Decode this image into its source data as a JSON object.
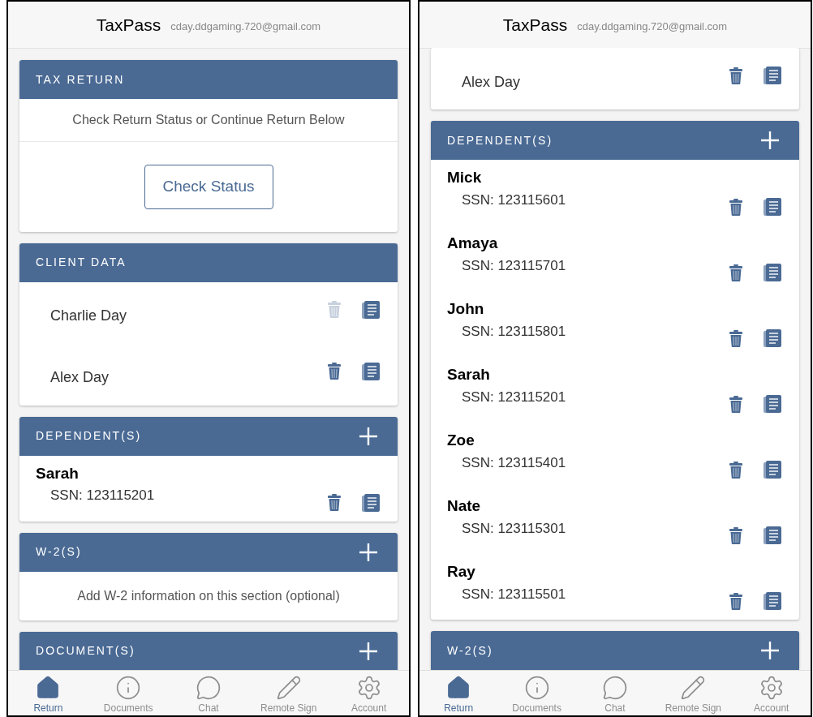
{
  "phones": [
    {
      "app_title": "TaxPass",
      "email": "cday.ddgaming.720@gmail.com",
      "sections": [
        {
          "kind": "status",
          "header": "TAX RETURN",
          "message": "Check Return Status or Continue Return Below",
          "button": "Check Status"
        },
        {
          "kind": "people",
          "header": "CLIENT DATA",
          "rows": [
            {
              "name": "Charlie Day",
              "delete_disabled": true
            },
            {
              "name": "Alex Day",
              "delete_disabled": false
            }
          ]
        },
        {
          "kind": "dependents",
          "header": "DEPENDENT(S)",
          "add": true,
          "rows": [
            {
              "name": "Sarah",
              "ssn": "SSN: 123115201",
              "delete_disabled": false
            }
          ]
        },
        {
          "kind": "note",
          "header": "W-2(S)",
          "add": true,
          "message": "Add W-2 information on this section (optional)"
        },
        {
          "kind": "header",
          "header": "DOCUMENT(S)",
          "add": true
        }
      ],
      "nav": [
        {
          "label": "Return",
          "selected": true
        },
        {
          "label": "Documents",
          "selected": false
        },
        {
          "label": "Chat",
          "selected": false
        },
        {
          "label": "Remote Sign",
          "selected": false
        },
        {
          "label": "Account",
          "selected": false
        }
      ]
    },
    {
      "app_title": "TaxPass",
      "email": "cday.ddgaming.720@gmail.com",
      "sections": [
        {
          "kind": "people",
          "rows": [
            {
              "name": "Alex Day",
              "delete_disabled": false
            }
          ]
        },
        {
          "kind": "dependents",
          "header": "DEPENDENT(S)",
          "add": true,
          "rows": [
            {
              "name": "Mick",
              "ssn": "SSN: 123115601",
              "delete_disabled": false
            },
            {
              "name": "Amaya",
              "ssn": "SSN: 123115701",
              "delete_disabled": false
            },
            {
              "name": "John",
              "ssn": "SSN: 123115801",
              "delete_disabled": false
            },
            {
              "name": "Sarah",
              "ssn": "SSN: 123115201",
              "delete_disabled": false
            },
            {
              "name": "Zoe",
              "ssn": "SSN: 123115401",
              "delete_disabled": false
            },
            {
              "name": "Nate",
              "ssn": "SSN: 123115301",
              "delete_disabled": false
            },
            {
              "name": "Ray",
              "ssn": "SSN: 123115501",
              "delete_disabled": false
            }
          ]
        },
        {
          "kind": "header",
          "header": "W-2(S)",
          "add": true
        }
      ],
      "nav": [
        {
          "label": "Return",
          "selected": true
        },
        {
          "label": "Documents",
          "selected": false
        },
        {
          "label": "Chat",
          "selected": false
        },
        {
          "label": "Remote Sign",
          "selected": false
        },
        {
          "label": "Account",
          "selected": false
        }
      ]
    }
  ]
}
